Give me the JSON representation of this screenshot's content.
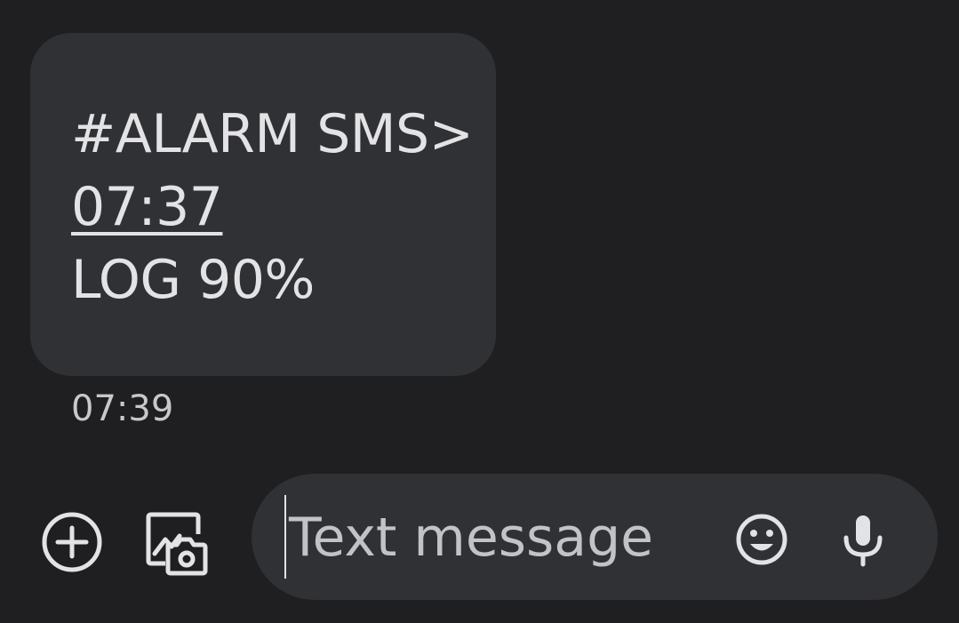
{
  "message": {
    "line1": "#ALARM SMS>",
    "line2": "07:37",
    "line3": "LOG 90%",
    "timestamp": "07:39"
  },
  "compose": {
    "placeholder": "Text message",
    "icons": {
      "add": "add-circle-icon",
      "gallery": "gallery-camera-icon",
      "emoji": "emoji-icon",
      "mic": "microphone-icon"
    }
  },
  "colors": {
    "background": "#1f1f21",
    "bubble": "#303134",
    "text": "#e3e3e6"
  }
}
